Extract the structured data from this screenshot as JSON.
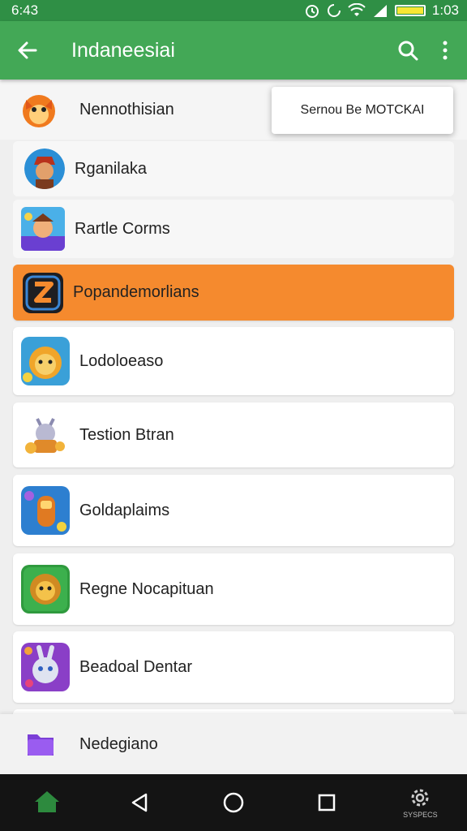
{
  "status_bar": {
    "time_left": "6:43",
    "time_right": "1:03"
  },
  "app_bar": {
    "title": "Indaneesiai",
    "back_icon": "arrow-left-icon",
    "search_icon": "search-icon",
    "menu_icon": "more-vert-icon"
  },
  "popup": {
    "label": "Sernou Be MOTCKAI"
  },
  "items": [
    {
      "label": "Nennothisian",
      "icon": "fox-mascot-icon"
    },
    {
      "label": "Rganilaka",
      "icon": "warrior-avatar-icon"
    },
    {
      "label": "Rartle Corms",
      "icon": "game-heroes-icon"
    },
    {
      "label": "Popandemorlians",
      "icon": "z-app-icon",
      "selected": true
    },
    {
      "label": "Lodoloeaso",
      "icon": "lion-game-icon"
    },
    {
      "label": "Testion Btran",
      "icon": "robot-game-icon"
    },
    {
      "label": "Goldaplaims",
      "icon": "rocket-game-icon"
    },
    {
      "label": "Regne Nocapituan",
      "icon": "lion-green-icon"
    },
    {
      "label": "Beadoal Dentar",
      "icon": "bunny-game-icon"
    }
  ],
  "bottom_item": {
    "label": "Nedegiano",
    "icon": "purple-folder-icon"
  },
  "nav_bar": {
    "home_label": "",
    "settings_label": "SYSPECS"
  },
  "colors": {
    "status_bar": "#2f8f45",
    "app_bar": "#43a856",
    "selected_row": "#f58a2e",
    "nav_bar": "#141414"
  }
}
